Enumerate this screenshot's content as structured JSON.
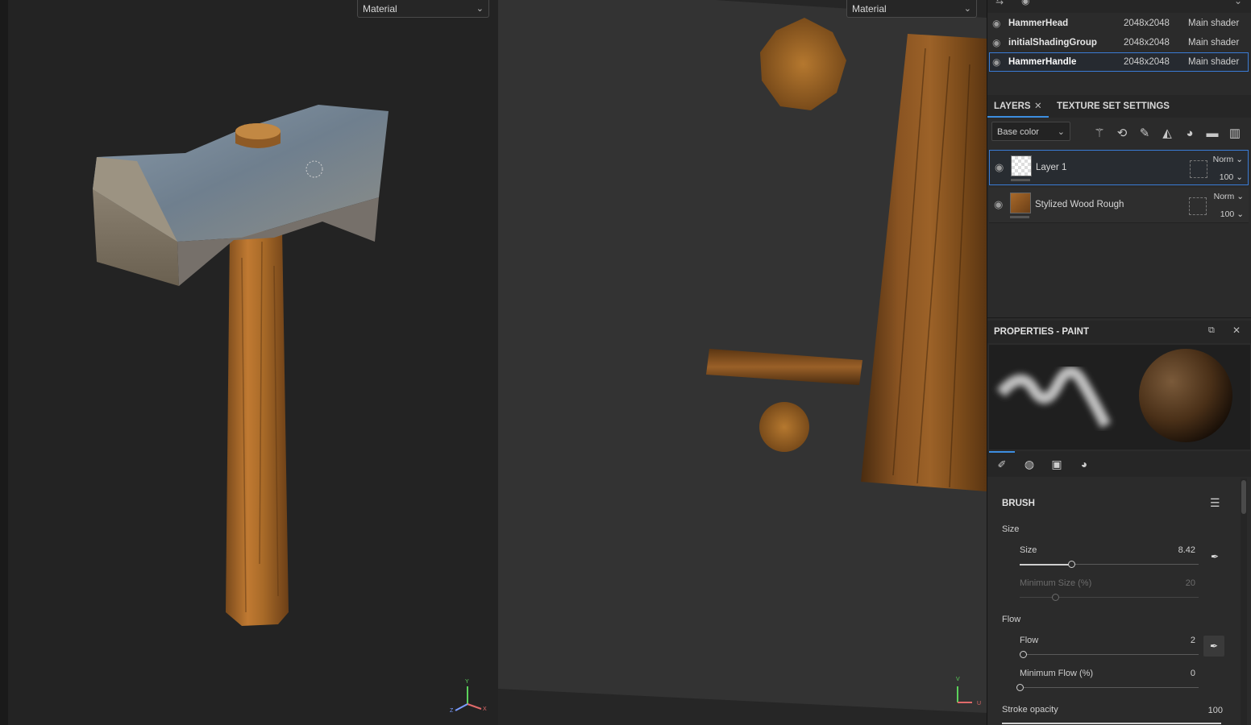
{
  "viewport3d": {
    "render_mode": "Material"
  },
  "viewport2d": {
    "render_mode": "Material"
  },
  "texture_sets": [
    {
      "name": "HammerHead",
      "resolution": "2048x2048",
      "shader": "Main shader",
      "selected": false
    },
    {
      "name": "initialShadingGroup",
      "resolution": "2048x2048",
      "shader": "Main shader",
      "selected": false
    },
    {
      "name": "HammerHandle",
      "resolution": "2048x2048",
      "shader": "Main shader",
      "selected": true
    }
  ],
  "layers_panel": {
    "tab_layers": "LAYERS",
    "tab_texture_set_settings": "TEXTURE SET SETTINGS",
    "channel": "Base color",
    "layers": [
      {
        "name": "Layer 1",
        "blend": "Norm",
        "opacity": "100",
        "selected": true
      },
      {
        "name": "Stylized Wood Rough",
        "blend": "Norm",
        "opacity": "100",
        "selected": false
      }
    ]
  },
  "properties": {
    "title": "PROPERTIES - PAINT",
    "brush": {
      "title": "BRUSH",
      "size_group": "Size",
      "size_label": "Size",
      "size_value": "8.42",
      "size_fraction": 0.29,
      "min_size_label": "Minimum Size (%)",
      "min_size_value": "20",
      "min_size_fraction": 0.2,
      "flow_group": "Flow",
      "flow_label": "Flow",
      "flow_value": "2",
      "flow_fraction": 0.02,
      "min_flow_label": "Minimum Flow (%)",
      "min_flow_value": "0",
      "min_flow_fraction": 0.0,
      "stroke_opacity_label": "Stroke opacity",
      "stroke_opacity_value": "100"
    }
  },
  "axis_gizmo_3d": {
    "y": "Y",
    "x": "X",
    "z": "Z"
  },
  "axis_gizmo_2d": {
    "v": "V",
    "u": "U"
  }
}
